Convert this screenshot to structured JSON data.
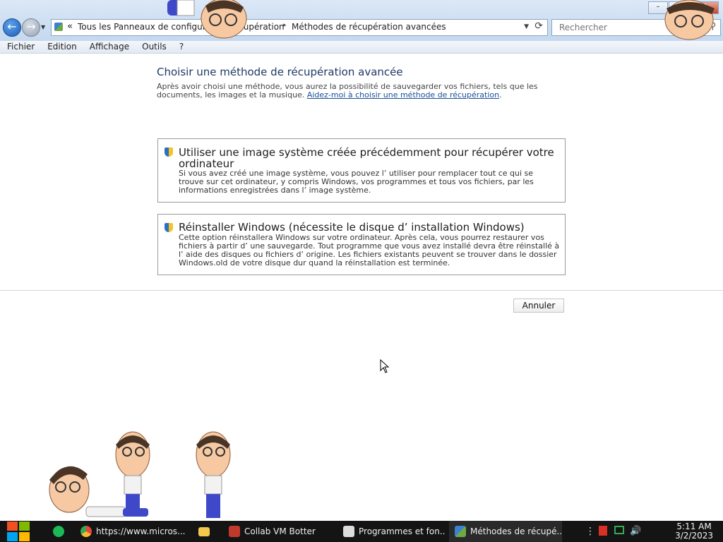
{
  "window": {
    "buttons": {
      "minimize": "–",
      "maximize": "□",
      "close": "✕"
    }
  },
  "address_bar": {
    "chevron": "«",
    "crumbs": [
      "Tous les Panneaux de configura",
      "Récupération",
      "Méthodes de récupération avancées"
    ],
    "separator": "▸"
  },
  "search": {
    "placeholder": "Rechercher"
  },
  "menu": [
    "Fichier",
    "Edition",
    "Affichage",
    "Outils",
    "?"
  ],
  "content": {
    "heading": "Choisir une méthode de récupération avancée",
    "intro": "Après avoir choisi une méthode, vous aurez la possibilité de sauvegarder vos fichiers, tels que les documents, les images et la musique.",
    "help_link": "Aidez-moi à choisir une méthode de récupération",
    "options": [
      {
        "title": "Utiliser une image système créée précédemment pour récupérer votre ordinateur",
        "description": "Si vous avez créé une image système, vous pouvez l’ utiliser pour remplacer tout ce qui se trouve sur cet ordinateur, y compris Windows, vos programmes et tous vos fichiers, par les informations enregistrées dans l’ image système."
      },
      {
        "title": "Réinstaller Windows (nécessite le disque d’ installation Windows)",
        "description": "Cette option réinstallera Windows sur votre ordinateur. Après cela, vous pourrez restaurer vos fichiers à partir d’ une sauvegarde. Tout programme que vous avez installé devra être réinstallé à l’ aide des disques ou fichiers d’ origine. Les fichiers existants peuvent se trouver dans le dossier Windows.old de votre disque dur quand la réinstallation est terminée."
      }
    ],
    "cancel_label": "Annuler"
  },
  "taskbar": {
    "items": [
      {
        "label": "",
        "icon": "spotify-icon",
        "color": "#1db954"
      },
      {
        "label": "https://www.micros...",
        "icon": "chrome-icon",
        "color": "#e8453c"
      },
      {
        "label": "",
        "icon": "folder-icon",
        "color": "#f2c94c"
      },
      {
        "label": "Collab VM Botter",
        "icon": "app-icon",
        "color": "#c0392b"
      },
      {
        "label": "Programmes et fon...",
        "icon": "document-icon",
        "color": "#dcdcdc"
      },
      {
        "label": "Méthodes de récupé...",
        "icon": "control-panel-icon",
        "color": "#3d7fd1"
      }
    ],
    "clock": {
      "time": "5:11 AM",
      "date": "3/2/2023"
    }
  },
  "colors": {
    "heading": "#1e3a66",
    "link": "#1a4f95",
    "taskbar": "#141414"
  }
}
